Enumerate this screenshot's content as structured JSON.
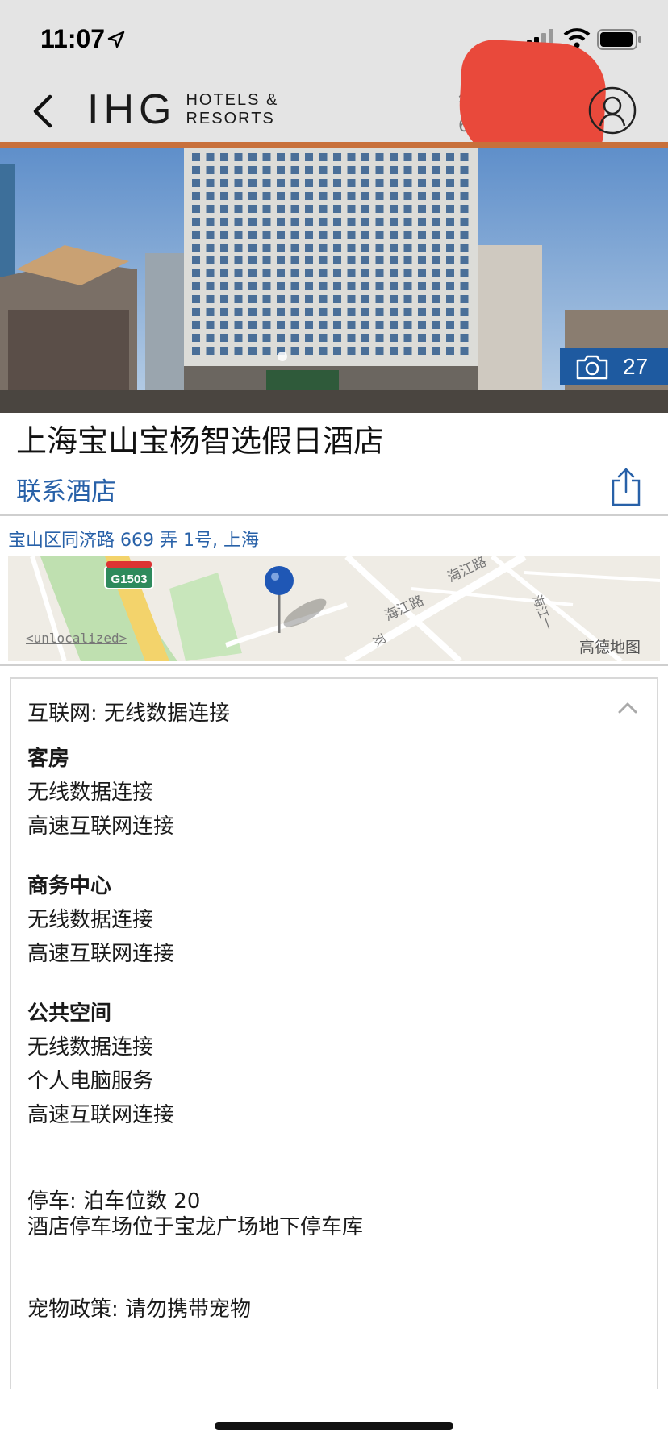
{
  "status_bar": {
    "time": "11:07"
  },
  "header": {
    "logo_main": "IHG",
    "logo_sub_line1": "HOTELS &",
    "logo_sub_line2": "RESORTS",
    "user_name_line1": "钦",
    "user_name_line2": "68"
  },
  "hero": {
    "photo_count": "27"
  },
  "hotel": {
    "name": "上海宝山宝杨智选假日酒店",
    "contact_label": "联系酒店",
    "address": "宝山区同济路 669 弄 1号, 上海"
  },
  "map": {
    "highway_shield": "G1503",
    "road_1": "海江路",
    "road_2": "海江路",
    "road_3": "海江一",
    "road_4": "双",
    "unlocalized": "<unlocalized>",
    "provider": "高德地图"
  },
  "amenities": {
    "internet_heading": "互联网: 无线数据连接",
    "sections": [
      {
        "title": "客房",
        "items": [
          "无线数据连接",
          "高速互联网连接"
        ]
      },
      {
        "title": "商务中心",
        "items": [
          "无线数据连接",
          "高速互联网连接"
        ]
      },
      {
        "title": "公共空间",
        "items": [
          "无线数据连接",
          "个人电脑服务",
          "高速互联网连接"
        ]
      }
    ],
    "parking_line1": "停车: 泊车位数 20",
    "parking_line2": "酒店停车场位于宝龙广场地下停车库",
    "pet_policy": "宠物政策: 请勿携带宠物"
  },
  "colors": {
    "accent_blue": "#2861a8",
    "header_gray": "#e4e4e4",
    "rule_orange": "#c8703b",
    "photo_badge": "#1e5aa0"
  }
}
